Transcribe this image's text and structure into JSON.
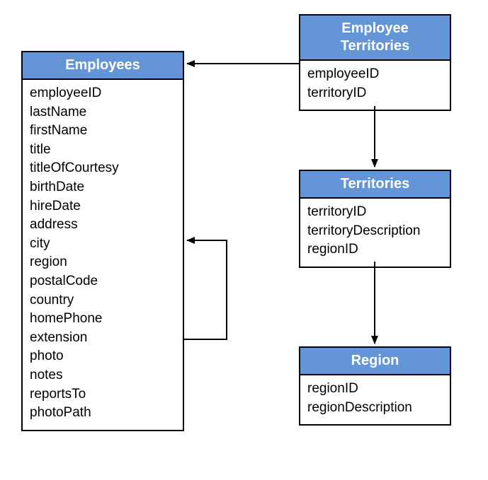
{
  "entities": {
    "employees": {
      "title": "Employees",
      "fields": [
        "employeeID",
        "lastName",
        "firstName",
        "title",
        "titleOfCourtesy",
        "birthDate",
        "hireDate",
        "address",
        "city",
        "region",
        "postalCode",
        "country",
        "homePhone",
        "extension",
        "photo",
        "notes",
        "reportsTo",
        "photoPath"
      ]
    },
    "employeeTerritories": {
      "title": "Employee Territories",
      "fields": [
        "employeeID",
        "territoryID"
      ]
    },
    "territories": {
      "title": "Territories",
      "fields": [
        "territoryID",
        "territoryDescription",
        "regionID"
      ]
    },
    "region": {
      "title": "Region",
      "fields": [
        "regionID",
        "regionDescription"
      ]
    }
  }
}
